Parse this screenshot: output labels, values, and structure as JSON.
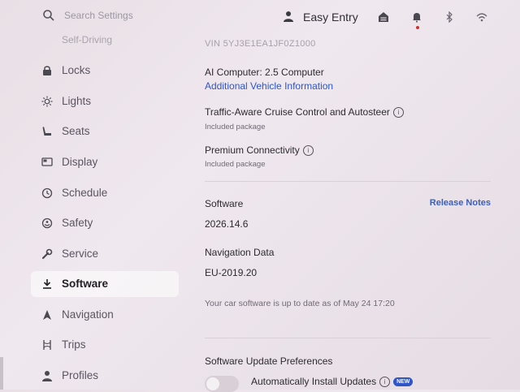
{
  "search": {
    "placeholder": "Search Settings"
  },
  "header": {
    "profile_name": "Easy Entry"
  },
  "sidebar": {
    "cut_item": "Self-Driving",
    "items": [
      {
        "label": "Locks",
        "icon": "lock-icon"
      },
      {
        "label": "Lights",
        "icon": "sun-icon"
      },
      {
        "label": "Seats",
        "icon": "seat-icon"
      },
      {
        "label": "Display",
        "icon": "display-icon"
      },
      {
        "label": "Schedule",
        "icon": "clock-icon"
      },
      {
        "label": "Safety",
        "icon": "safety-icon"
      },
      {
        "label": "Service",
        "icon": "wrench-icon"
      },
      {
        "label": "Software",
        "icon": "download-icon",
        "selected": true
      },
      {
        "label": "Navigation",
        "icon": "navigation-icon"
      },
      {
        "label": "Trips",
        "icon": "trips-icon"
      },
      {
        "label": "Profiles",
        "icon": "profile-icon"
      }
    ]
  },
  "vehicle": {
    "vin": "VIN 5YJ3E1EA1JF0Z1000",
    "ai_computer": "AI Computer: 2.5 Computer",
    "additional_info_link": "Additional Vehicle Information",
    "packages": [
      {
        "name": "Traffic-Aware Cruise Control and Autosteer",
        "status": "Included package"
      },
      {
        "name": "Premium Connectivity",
        "status": "Included package"
      }
    ]
  },
  "software": {
    "heading": "Software",
    "release_notes_link": "Release Notes",
    "version": "2026.14.6",
    "nav_heading": "Navigation Data",
    "nav_version": "EU-2019.20",
    "update_status": "Your car software is up to date as of May 24 17:20"
  },
  "preferences": {
    "heading": "Software Update Preferences",
    "auto_install_label": "Automatically Install Updates",
    "new_badge": "NEW",
    "auto_install_enabled": false
  },
  "colors": {
    "accent": "#2f55c8",
    "background": "#ebe2e9"
  }
}
